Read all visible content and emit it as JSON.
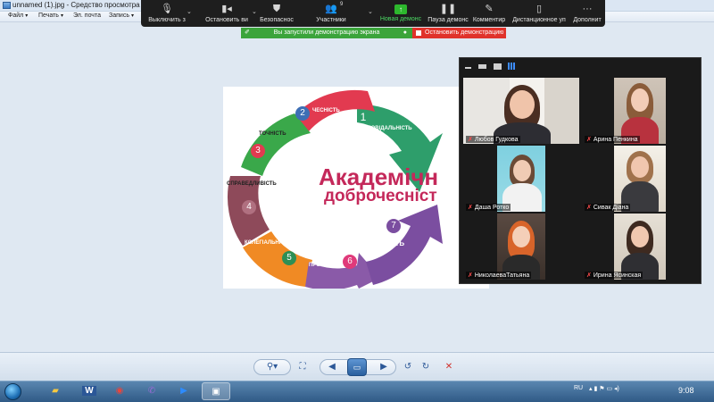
{
  "window": {
    "title": "unnamed (1).jpg - Средство просмотра фо",
    "menu": [
      {
        "label": "Файл",
        "caret": true
      },
      {
        "label": "Печать",
        "caret": true
      },
      {
        "label": "Эл. почта",
        "caret": false
      },
      {
        "label": "Запись",
        "caret": true
      }
    ]
  },
  "zoom_toolbar": {
    "buttons": [
      {
        "label": "Выключить з",
        "icon": "microphone-icon"
      },
      {
        "label": "Остановить ви",
        "icon": "camera-icon"
      },
      {
        "label": "Безопаснос",
        "icon": "shield-icon"
      },
      {
        "label": "Участники",
        "icon": "people-icon",
        "badge": "9"
      },
      {
        "label": "Новая демонс",
        "icon": "share-screen-icon",
        "active": true
      },
      {
        "label": "Пауза демонс",
        "icon": "pause-icon"
      },
      {
        "label": "Комментир",
        "icon": "pen-icon"
      },
      {
        "label": "Дистанционное уп",
        "icon": "mouse-icon"
      },
      {
        "label": "Дополнит",
        "icon": "more-icon"
      }
    ],
    "share_banner": "Вы запустили демонстрацию экрана",
    "stop_share": "Остановить демонстрацию",
    "share_color": "#3ba43b",
    "stop_color": "#e0322b"
  },
  "slide": {
    "heading_line1": "Академічн",
    "heading_line2": "доброчесніст",
    "segments": [
      {
        "num": "1",
        "label": "ВІДПОВІДАЛЬНІСТЬ",
        "color": "#2e9e6b"
      },
      {
        "num": "2",
        "label": "ЧЕСНІСТЬ",
        "color": "#e23a50"
      },
      {
        "num": "3",
        "label": "ТОЧНІСТЬ",
        "color": "#3aa84a"
      },
      {
        "num": "4",
        "label": "СПРАВЕДЛИВІСТЬ",
        "color": "#8e4a5a"
      },
      {
        "num": "5",
        "label": "КОЛЕГІАЛЬНІСТЬ",
        "color": "#f08a24"
      },
      {
        "num": "6",
        "label": "ПРОЗОРІСТЬ",
        "color": "#8a5aa8"
      },
      {
        "num": "7",
        "label": "ГУМАНІСТЬ",
        "color": "#7b4ea0"
      }
    ]
  },
  "gallery": {
    "participants": [
      {
        "name": "Любов Гудкова"
      },
      {
        "name": "Арина Пенкина"
      },
      {
        "name": "Даша Ротко"
      },
      {
        "name": "Сивак Діана"
      },
      {
        "name": "НиколаеваТатьяна"
      },
      {
        "name": "Ирина Ясинская"
      }
    ]
  },
  "taskbar": {
    "language": "RU",
    "time": "9:08"
  }
}
